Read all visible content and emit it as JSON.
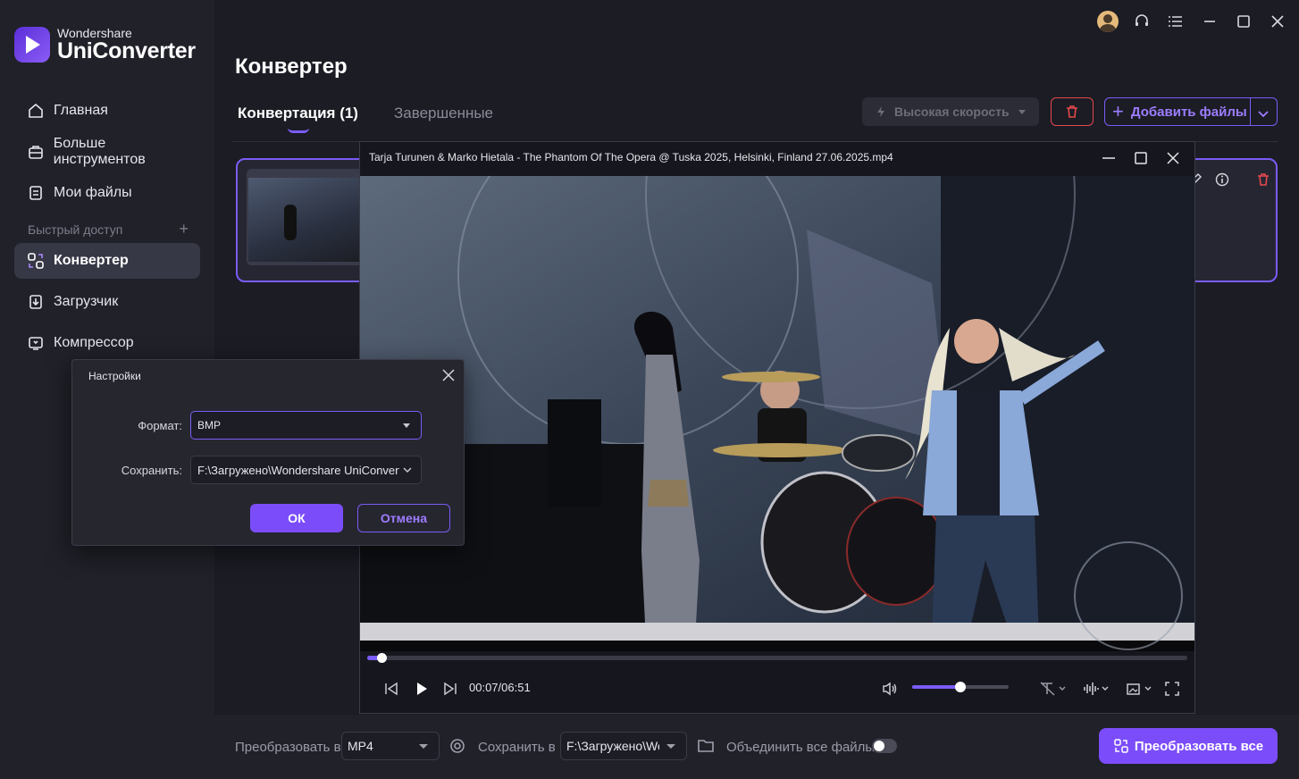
{
  "brand": {
    "small": "Wondershare",
    "big": "UniConverter"
  },
  "sidebar": {
    "items": [
      {
        "label": "Главная"
      },
      {
        "label": "Больше инструментов"
      },
      {
        "label": "Мои файлы"
      }
    ],
    "quick_access": "Быстрый доступ",
    "quick_items": [
      {
        "label": "Конвертер"
      },
      {
        "label": "Загрузчик"
      },
      {
        "label": "Компрессор"
      }
    ]
  },
  "main": {
    "title": "Конвертер",
    "tabs": [
      {
        "label": "Конвертация (1)"
      },
      {
        "label": "Завершенные"
      }
    ],
    "speed_label": "Высокая скорость",
    "add_files_label": "Добавить файлы"
  },
  "player": {
    "title": "Tarja Turunen & Marko Hietala - The Phantom Of The Opera @ Tuska 2025, Helsinki, Finland 27.06.2025.mp4",
    "time": "00:07/06:51",
    "progress": 0.017,
    "volume": 0.5
  },
  "dialog": {
    "title": "Настройки",
    "format_label": "Формат:",
    "format_value": "BMP",
    "save_label": "Сохранить:",
    "save_value": "F:\\Загружено\\Wondershare UniConverter",
    "ok": "ОК",
    "cancel": "Отмена"
  },
  "bottom": {
    "convert_to_label": "Преобразовать в",
    "convert_to_value": "MP4",
    "save_to_label": "Сохранить в",
    "save_to_value": "F:\\Загружено\\Wondershare",
    "merge_label": "Объединить все файлы",
    "convert_all": "Преобразовать все"
  },
  "colors": {
    "accent": "#7b4dfa",
    "danger": "#e5484d"
  }
}
